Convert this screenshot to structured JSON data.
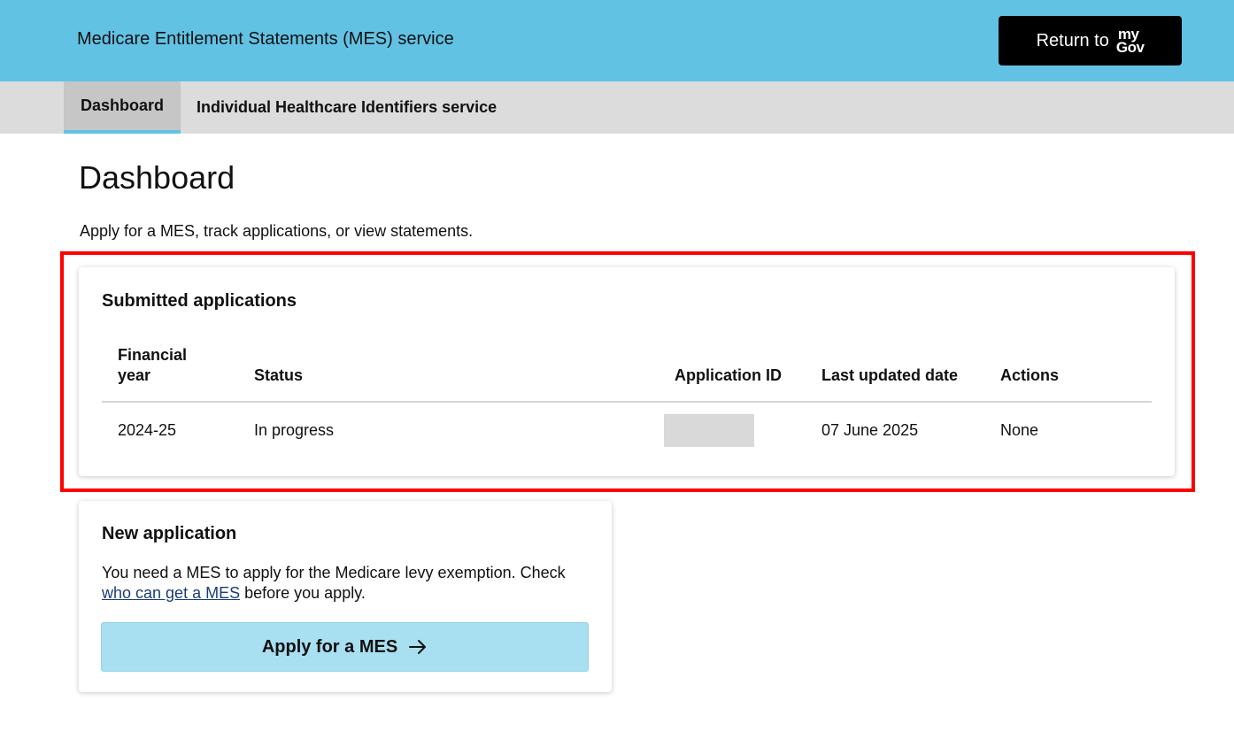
{
  "header": {
    "title": "Medicare Entitlement Statements (MES) service",
    "return_label": "Return to",
    "mygov_logo": [
      "my",
      "Gov"
    ]
  },
  "nav": {
    "tabs": [
      {
        "label": "Dashboard",
        "active": true
      },
      {
        "label": "Individual Healthcare Identifiers service",
        "active": false
      }
    ]
  },
  "main": {
    "title": "Dashboard",
    "intro": "Apply for a MES, track applications, or view statements."
  },
  "submitted": {
    "heading": "Submitted applications",
    "columns": [
      "Financial year",
      "Status",
      "Application ID",
      "Last updated date",
      "Actions"
    ],
    "columns_wrapped": {
      "financial_year_line1": "Financial",
      "financial_year_line2": "year"
    },
    "rows": [
      {
        "financial_year": "2024-25",
        "status": "In progress",
        "application_id": "",
        "last_updated": "07 June 2025",
        "actions": "None"
      }
    ]
  },
  "new_application": {
    "heading": "New application",
    "text_before_link": "You need a MES to apply for the Medicare levy exemption. Check",
    "link_text": "who can get a MES",
    "text_after_link": "before you apply.",
    "apply_button": "Apply for a MES"
  },
  "colors": {
    "header_bg": "#62c2e4",
    "nav_bg": "#dcdcdc",
    "active_tab_bg": "#c6c6c6",
    "highlight_border": "#ff0000",
    "button_bg": "#a8dff1",
    "link": "#1a3d78"
  },
  "icons": {
    "apply_arrow": "arrow-right-icon"
  }
}
